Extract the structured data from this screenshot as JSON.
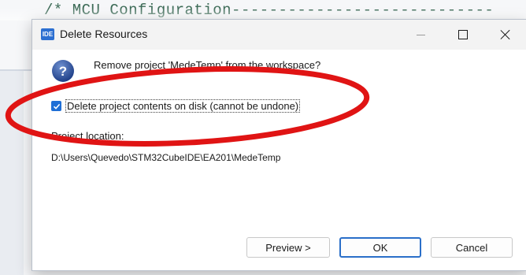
{
  "background": {
    "code_line": "/* MCU Configuration----------------------------"
  },
  "dialog": {
    "app_icon_text": "IDE",
    "title": "Delete Resources",
    "prompt": "Remove project 'MedeTemp' from the workspace?",
    "delete_checkbox": {
      "label": "Delete project contents on disk (cannot be undone)",
      "checked": true
    },
    "location_label": "Project location:",
    "location_value": "D:\\Users\\Quevedo\\STM32CubeIDE\\EA201\\MedeTemp",
    "buttons": {
      "preview": "Preview >",
      "ok": "OK",
      "cancel": "Cancel"
    }
  },
  "colors": {
    "accent": "#1f6fd6",
    "annotation": "#e01414"
  },
  "icons": {
    "question": "question-icon",
    "minimize": "minimize-icon",
    "maximize": "maximize-icon",
    "close": "close-icon",
    "checkmark": "checkmark-icon"
  }
}
